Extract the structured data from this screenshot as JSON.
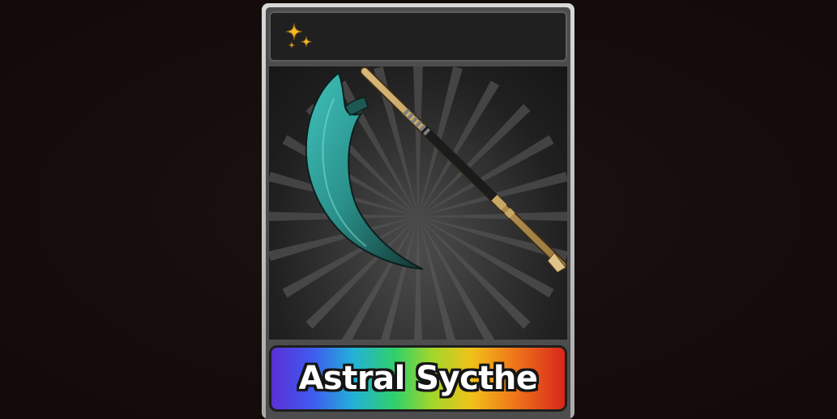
{
  "card": {
    "rarity_icon": "sparkle-icon",
    "item_name": "Astral Sycthe",
    "item_art_icon": "scythe-weapon",
    "colors": {
      "background": "#140c0b",
      "card_frame": "#c4c4c4",
      "header_bg": "#202020",
      "nameplate_gradient": [
        "#5b2fd6",
        "#3f5bf0",
        "#22b1d8",
        "#2fd06a",
        "#a3d62a",
        "#f0c21a",
        "#f07a1a",
        "#d8261a"
      ],
      "sparkle": "#f2b92a",
      "blade": "#2e8f8a"
    }
  }
}
